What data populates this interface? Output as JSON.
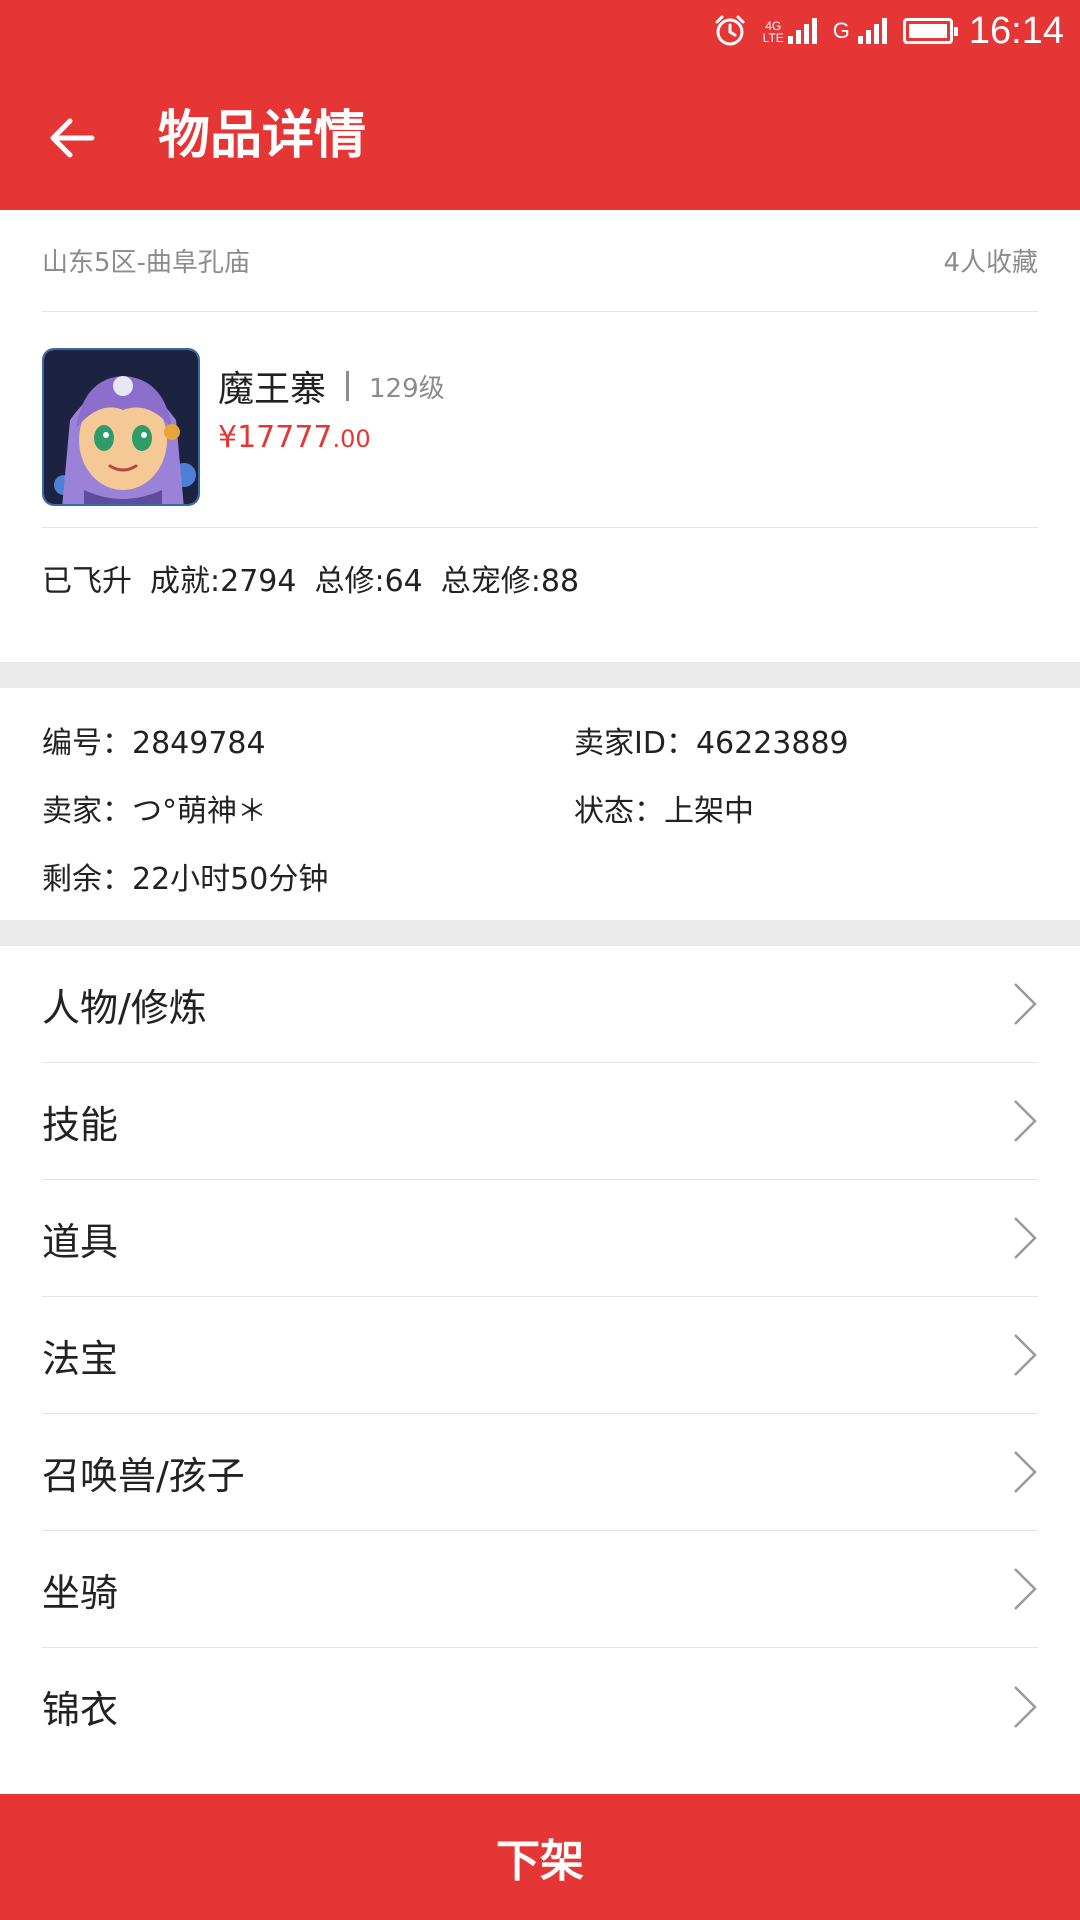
{
  "status_bar": {
    "time": "16:14",
    "network_4g": "4G",
    "network_lte": "LTE",
    "network_g": "G",
    "icons": [
      "alarm-icon",
      "signal-icon",
      "signal-icon",
      "battery-icon"
    ]
  },
  "app_bar": {
    "title": "物品详情",
    "back_icon": "arrow-left-icon"
  },
  "summary": {
    "server": "山东5区-曲阜孔庙",
    "favorites": "4人收藏",
    "role_name": "魔王寨",
    "role_level": "129级",
    "price_int": "¥17777",
    "price_dec": ".00",
    "tags": [
      "已飞升",
      "成就:2794",
      "总修:64",
      "总宠修:88"
    ]
  },
  "info": {
    "id_label": "编号：",
    "id_value": "2849784",
    "seller_id_label": "卖家ID：",
    "seller_id_value": "46223889",
    "seller_label": "卖家：",
    "seller_value": "つ°萌神＊",
    "status_label": "状态：",
    "status_value": "上架中",
    "remain_label": "剩余：",
    "remain_value": "22小时50分钟"
  },
  "menu": [
    {
      "label": "人物/修炼"
    },
    {
      "label": "技能"
    },
    {
      "label": "道具"
    },
    {
      "label": "法宝"
    },
    {
      "label": "召唤兽/孩子"
    },
    {
      "label": "坐骑"
    },
    {
      "label": "锦衣"
    }
  ],
  "bottom_button": {
    "label": "下架"
  },
  "colors": {
    "brand_red": "#e53534",
    "divider": "#ebebeb",
    "muted_text": "#8c8c8c"
  }
}
